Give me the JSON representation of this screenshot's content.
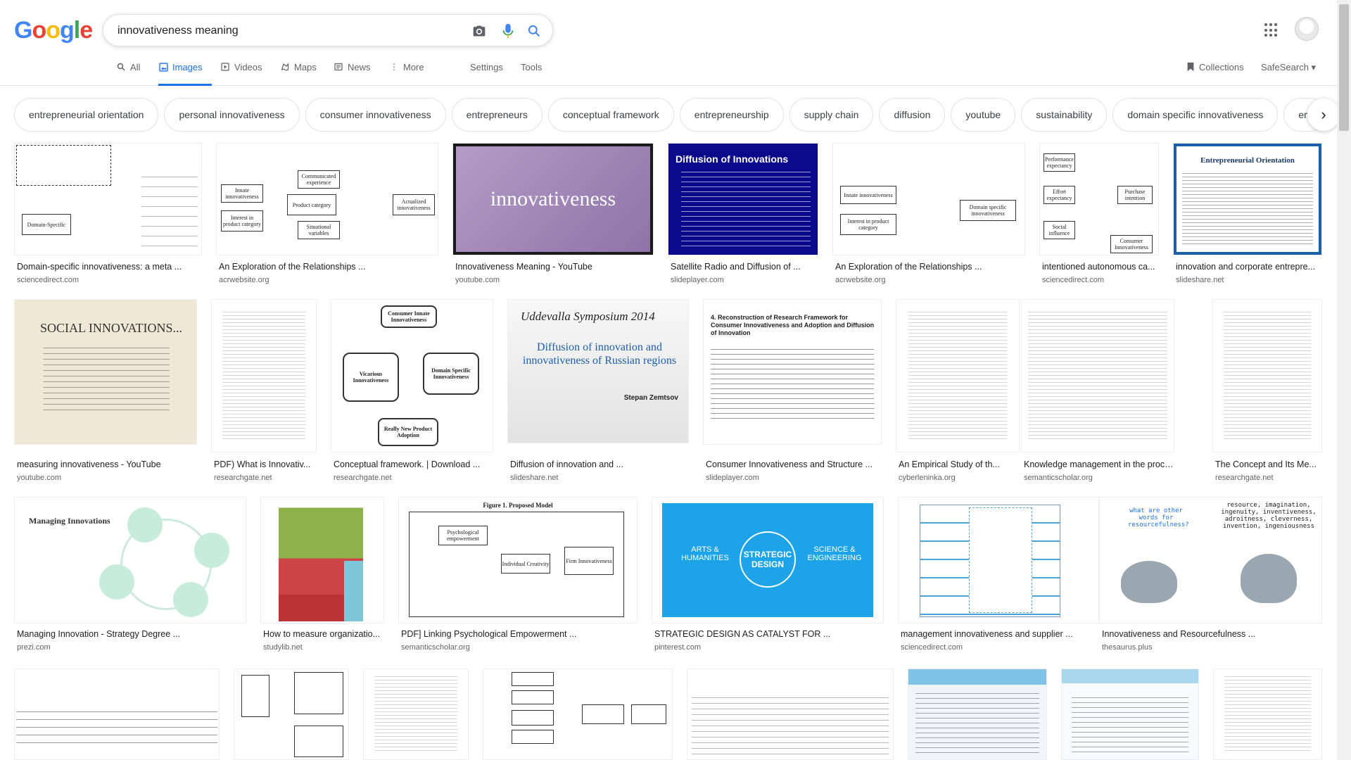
{
  "search": {
    "query": "innovativeness meaning"
  },
  "logo": [
    "G",
    "o",
    "o",
    "g",
    "l",
    "e"
  ],
  "tabs": [
    {
      "label": "All",
      "icon": "search-icon"
    },
    {
      "label": "Images",
      "icon": "image-icon",
      "active": true
    },
    {
      "label": "Videos",
      "icon": "play-icon"
    },
    {
      "label": "Maps",
      "icon": "map-icon"
    },
    {
      "label": "News",
      "icon": "news-icon"
    },
    {
      "label": "More",
      "icon": "more-vert-icon"
    }
  ],
  "tools": {
    "settings": "Settings",
    "tools": "Tools",
    "collections": "Collections",
    "safesearch": "SafeSearch ▾"
  },
  "chips": [
    "entrepreneurial orientation",
    "personal innovativeness",
    "consumer innovativeness",
    "entrepreneurs",
    "conceptual framework",
    "entrepreneurship",
    "supply chain",
    "diffusion",
    "youtube",
    "sustainability",
    "domain specific innovativeness",
    "em"
  ],
  "results": [
    {
      "caption": "Domain-specific innovativeness: a meta ...",
      "domain": "sciencedirect.com"
    },
    {
      "caption": "An Exploration of the Relationships ...",
      "domain": "acrwebsite.org"
    },
    {
      "caption": "Innovativeness Meaning - YouTube",
      "domain": "youtube.com"
    },
    {
      "caption": "Satellite Radio and Diffusion of ...",
      "domain": "slideplayer.com"
    },
    {
      "caption": "An Exploration of the Relationships ...",
      "domain": "acrwebsite.org"
    },
    {
      "caption": "intentioned autonomous ca...",
      "domain": "sciencedirect.com"
    },
    {
      "caption": "innovation and corporate entrepre...",
      "domain": "slideshare.net"
    },
    {
      "caption": "measuring innovativeness - YouTube",
      "domain": "youtube.com"
    },
    {
      "caption": "PDF) What is Innovativ...",
      "domain": "researchgate.net"
    },
    {
      "caption": "Conceptual framework. | Download ...",
      "domain": "researchgate.net"
    },
    {
      "caption": "Diffusion of innovation and ...",
      "domain": "slideshare.net"
    },
    {
      "caption": "Consumer Innovativeness and Structure ...",
      "domain": "slideplayer.com"
    },
    {
      "caption": "An Empirical Study of th...",
      "domain": "cyberleninka.org"
    },
    {
      "caption": "Knowledge management in the process o...",
      "domain": "semanticscholar.org"
    },
    {
      "caption": "The Concept and Its Me...",
      "domain": "researchgate.net"
    },
    {
      "caption": "Managing Innovation - Strategy Degree ...",
      "domain": "prezi.com"
    },
    {
      "caption": "How to measure organizatio...",
      "domain": "studylib.net"
    },
    {
      "caption": "PDF] Linking Psychological Empowerment ...",
      "domain": "semanticscholar.org"
    },
    {
      "caption": "STRATEGIC DESIGN AS CATALYST FOR ...",
      "domain": "pinterest.com"
    },
    {
      "caption": "management innovativeness and supplier ...",
      "domain": "sciencedirect.com"
    },
    {
      "caption": "Innovativeness and Resourcefulness ...",
      "domain": "thesaurus.plus"
    }
  ],
  "thumb_text": {
    "t3": "innovativeness",
    "t4_title": "Diffusion of Innovations",
    "t7_title": "Entrepreneurial Orientation",
    "t8_title": "SOCIAL INNOVATIONS...",
    "t11_title": "Uddevalla Symposium 2014",
    "t11_sub": "Diffusion of innovation and innovativeness of Russian regions",
    "t11_author": "Stepan Zemtsov",
    "t12_title": "4. Reconstruction of Research Framework for Consumer Innovativeness and Adoption and Diffusion of Innovation",
    "t16_title": "Managing Innovations",
    "t19_left": "ARTS & HUMANITIES",
    "t19_center": "STRATEGIC DESIGN",
    "t19_right": "SCIENCE & ENGINEERING",
    "t21_text": "resource, imagination, ingenuity, inventiveness, adroitness, cleverness, invention, ingeniousness",
    "t21_q": "what are other words for resourcefulness?",
    "t10_top": "Consumer Innate Innovativeness",
    "t10_left": "Vicarious Innovativeness",
    "t10_right": "Domain Specific Innovativeness",
    "t10_bottom": "Really New Product Adoption",
    "t18_title": "Figure 1. Proposed Model",
    "t18_a": "Psychological empowerment",
    "t18_b": "Individual Creativity",
    "t18_c": "Firm Innovativeness"
  },
  "colors": {
    "accent": "#1a73e8",
    "link_gray": "#5f6368"
  }
}
